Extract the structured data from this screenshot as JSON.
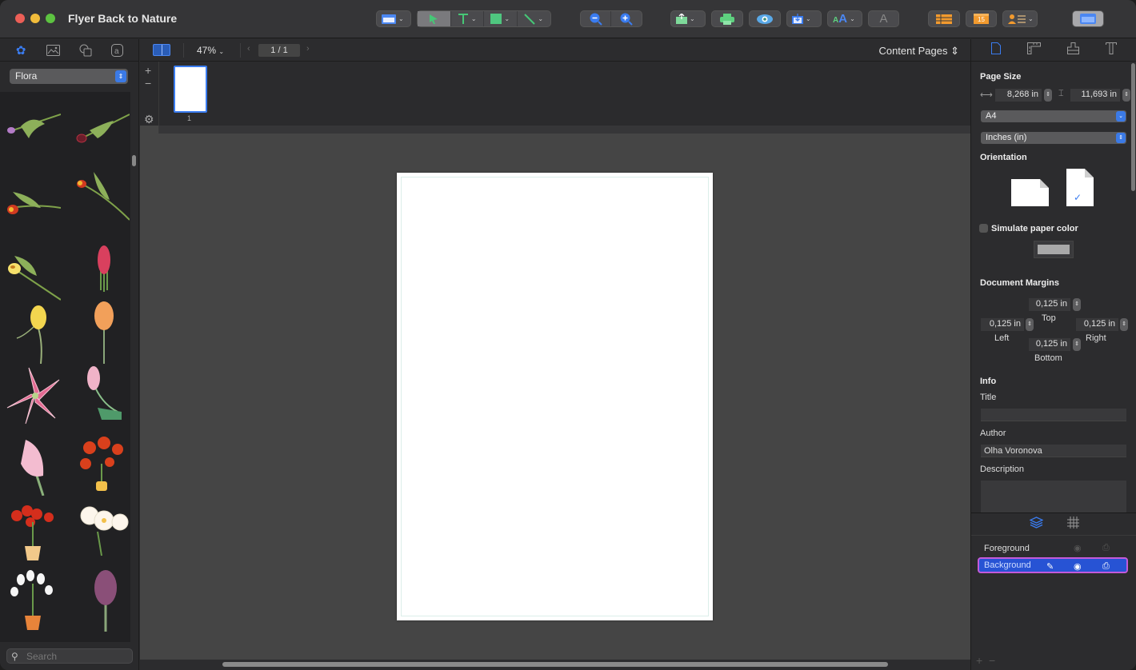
{
  "window": {
    "title": "Flyer Back to Nature"
  },
  "toolbar": {
    "groups": [
      {
        "name": "view-mode",
        "icons": [
          "window-layout-icon"
        ]
      },
      {
        "name": "tools",
        "icons": [
          "pointer-tool-icon",
          "text-tool-icon",
          "shape-tool-icon",
          "line-tool-icon"
        ]
      },
      {
        "name": "zoom",
        "icons": [
          "zoom-out-icon",
          "zoom-in-icon"
        ]
      },
      {
        "name": "export",
        "icons": [
          "share-icon",
          "print-icon",
          "preview-icon",
          "import-icon",
          "font-styles-icon",
          "text-format-icon"
        ]
      },
      {
        "name": "insert",
        "icons": [
          "table-icon",
          "calendar-icon",
          "contact-icon",
          "sidebar-toggle-icon"
        ]
      }
    ],
    "calendar_day": "15"
  },
  "left_panel": {
    "tabs": [
      "clipart-icon",
      "image-icon",
      "shapes-icon",
      "text-icon"
    ],
    "active_tab": 0,
    "category": "Flora",
    "items": [
      {
        "name": "purple-tulip-stem"
      },
      {
        "name": "dark-red-tulip-stem"
      },
      {
        "name": "red-yellow-tulip-stem"
      },
      {
        "name": "red-tulip-bud-stem"
      },
      {
        "name": "yellow-tulip-stem"
      },
      {
        "name": "red-ginger-bouquet"
      },
      {
        "name": "yellow-tulip"
      },
      {
        "name": "orange-tulip"
      },
      {
        "name": "pink-lily"
      },
      {
        "name": "pink-tulip-bud"
      },
      {
        "name": "pink-tulip"
      },
      {
        "name": "red-tulips-vase"
      },
      {
        "name": "red-tulips-pot"
      },
      {
        "name": "white-tulips-bowl"
      },
      {
        "name": "white-tulips-pot"
      },
      {
        "name": "purple-tulip"
      }
    ],
    "search": {
      "placeholder": "Search",
      "value": ""
    }
  },
  "canvas_bar": {
    "zoom": "47%",
    "page_indicator": "1 / 1",
    "page_set": "Content Pages"
  },
  "thumbnails": [
    {
      "label": "1",
      "selected": true
    }
  ],
  "inspector": {
    "tabs": [
      "document-icon",
      "layout-icon",
      "style-icon",
      "typography-icon"
    ],
    "active_tab": 0,
    "page_size": {
      "heading": "Page Size",
      "width": "8,268 in",
      "height": "11,693 in",
      "preset": "A4",
      "units": "Inches (in)"
    },
    "orientation": {
      "heading": "Orientation",
      "options": [
        "landscape",
        "portrait"
      ],
      "selected": "portrait"
    },
    "simulate_paper": {
      "label": "Simulate paper color",
      "checked": false,
      "color": "#a9a9a9"
    },
    "margins": {
      "heading": "Document Margins",
      "top": {
        "value": "0,125 in",
        "label": "Top"
      },
      "left": {
        "value": "0,125 in",
        "label": "Left"
      },
      "right": {
        "value": "0,125 in",
        "label": "Right"
      },
      "bottom": {
        "value": "0,125 in",
        "label": "Bottom"
      }
    },
    "info": {
      "heading": "Info",
      "title_label": "Title",
      "title_value": "",
      "author_label": "Author",
      "author_value": "Olha Voronova",
      "description_label": "Description",
      "description_value": ""
    }
  },
  "layers": {
    "tabs": [
      "layers-icon",
      "grid-icon"
    ],
    "items": [
      {
        "name": "Foreground",
        "selected": false,
        "visible": false,
        "printable": false
      },
      {
        "name": "Background",
        "selected": true,
        "visible": true,
        "printable": true
      }
    ]
  },
  "colors": {
    "accent": "#3a7cf0",
    "selection": "#2753d4",
    "selection_border": "#c45ad9"
  }
}
